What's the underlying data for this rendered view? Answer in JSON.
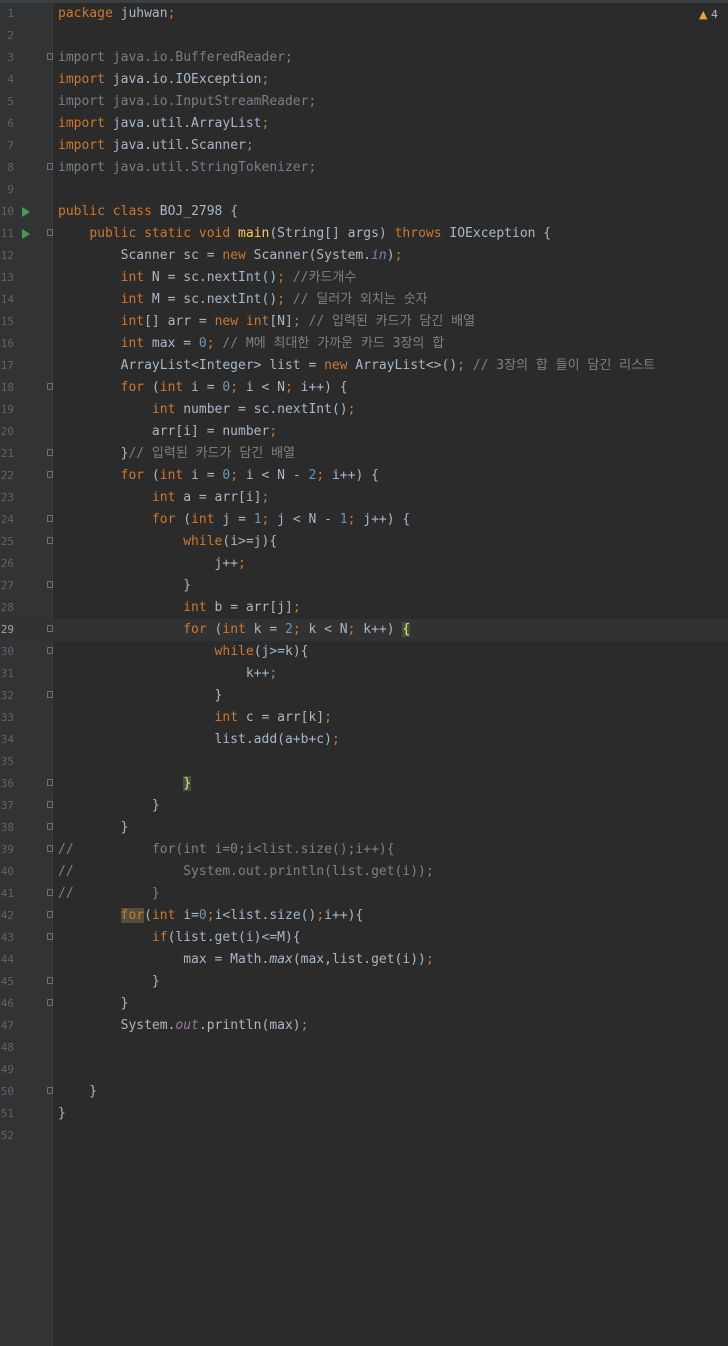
{
  "editor": {
    "warning_count": "4",
    "current_line": 29,
    "lines": [
      {
        "n": "1",
        "code": "package juhwan;"
      },
      {
        "n": "2",
        "code": ""
      },
      {
        "n": "3",
        "code": "import java.io.BufferedReader;"
      },
      {
        "n": "4",
        "code": "import java.io.IOException;"
      },
      {
        "n": "5",
        "code": "import java.io.InputStreamReader;"
      },
      {
        "n": "6",
        "code": "import java.util.ArrayList;"
      },
      {
        "n": "7",
        "code": "import java.util.Scanner;"
      },
      {
        "n": "8",
        "code": "import java.util.StringTokenizer;"
      },
      {
        "n": "9",
        "code": ""
      },
      {
        "n": "10",
        "code": "public class BOJ_2798 {"
      },
      {
        "n": "11",
        "code": "    public static void main(String[] args) throws IOException {"
      },
      {
        "n": "12",
        "code": "        Scanner sc = new Scanner(System.in);"
      },
      {
        "n": "13",
        "code": "        int N = sc.nextInt(); //카드개수"
      },
      {
        "n": "14",
        "code": "        int M = sc.nextInt(); // 딜러가 외치는 숫자"
      },
      {
        "n": "15",
        "code": "        int[] arr = new int[N]; // 입력된 카드가 담긴 배열"
      },
      {
        "n": "16",
        "code": "        int max = 0; // M에 최대한 가까운 카드 3장의 합"
      },
      {
        "n": "17",
        "code": "        ArrayList<Integer> list = new ArrayList<>(); // 3장의 합 들이 담긴 리스트"
      },
      {
        "n": "18",
        "code": "        for (int i = 0; i < N; i++) {"
      },
      {
        "n": "19",
        "code": "            int number = sc.nextInt();"
      },
      {
        "n": "20",
        "code": "            arr[i] = number;"
      },
      {
        "n": "21",
        "code": "        }// 입력된 카드가 담긴 배열"
      },
      {
        "n": "22",
        "code": "        for (int i = 0; i < N - 2; i++) {"
      },
      {
        "n": "23",
        "code": "            int a = arr[i];"
      },
      {
        "n": "24",
        "code": "            for (int j = 1; j < N - 1; j++) {"
      },
      {
        "n": "25",
        "code": "                while(i>=j){"
      },
      {
        "n": "26",
        "code": "                    j++;"
      },
      {
        "n": "27",
        "code": "                }"
      },
      {
        "n": "28",
        "code": "                int b = arr[j];"
      },
      {
        "n": "29",
        "code": "                for (int k = 2; k < N; k++) {"
      },
      {
        "n": "30",
        "code": "                    while(j>=k){"
      },
      {
        "n": "31",
        "code": "                        k++;"
      },
      {
        "n": "32",
        "code": "                    }"
      },
      {
        "n": "33",
        "code": "                    int c = arr[k];"
      },
      {
        "n": "34",
        "code": "                    list.add(a+b+c);"
      },
      {
        "n": "35",
        "code": ""
      },
      {
        "n": "36",
        "code": "                }"
      },
      {
        "n": "37",
        "code": "            }"
      },
      {
        "n": "38",
        "code": "        }"
      },
      {
        "n": "39",
        "code": "//          for(int i=0;i<list.size();i++){"
      },
      {
        "n": "40",
        "code": "//              System.out.println(list.get(i));"
      },
      {
        "n": "41",
        "code": "//          }"
      },
      {
        "n": "42",
        "code": "        for(int i=0;i<list.size();i++){"
      },
      {
        "n": "43",
        "code": "            if(list.get(i)<=M){"
      },
      {
        "n": "44",
        "code": "                max = Math.max(max,list.get(i));"
      },
      {
        "n": "45",
        "code": "            }"
      },
      {
        "n": "46",
        "code": "        }"
      },
      {
        "n": "47",
        "code": "        System.out.println(max);"
      },
      {
        "n": "48",
        "code": ""
      },
      {
        "n": "49",
        "code": ""
      },
      {
        "n": "50",
        "code": "    }"
      },
      {
        "n": "51",
        "code": "}"
      },
      {
        "n": "52",
        "code": ""
      }
    ]
  }
}
